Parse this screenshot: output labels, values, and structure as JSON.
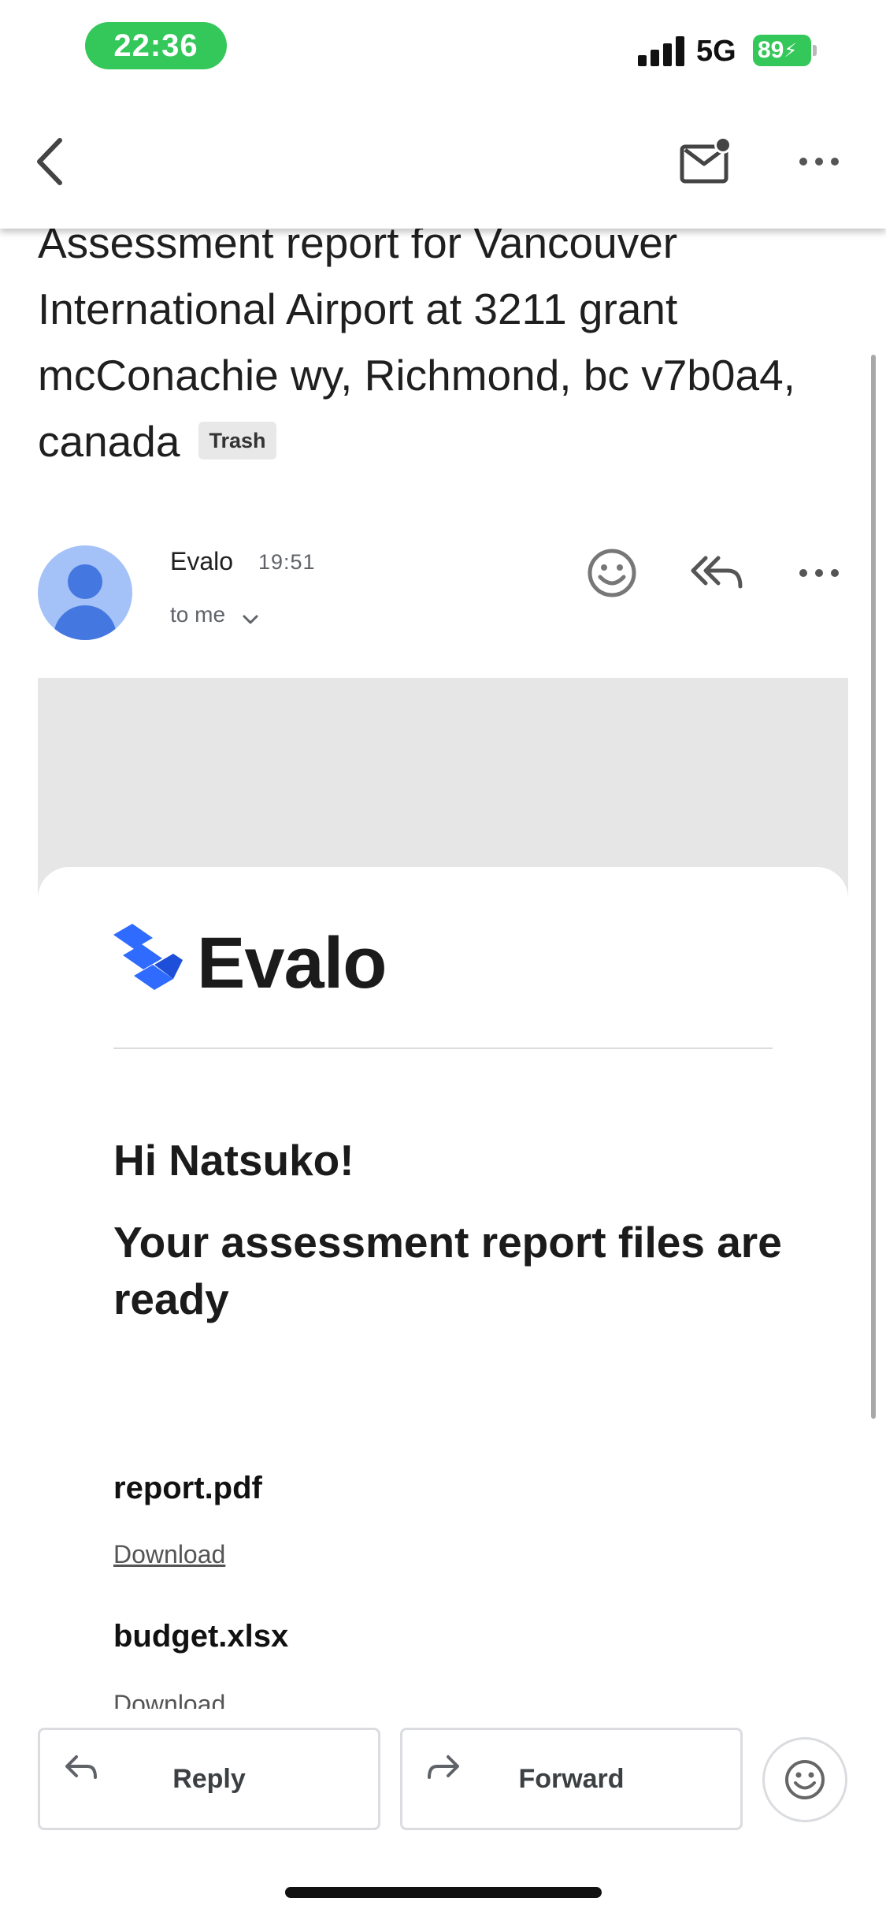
{
  "status_bar": {
    "time": "22:36",
    "network": "5G",
    "battery": "89",
    "accent_color": "#34c759"
  },
  "toolbar": {
    "back_icon": "chevron-left-icon",
    "mail_icon": "mark-unread-icon",
    "more_icon": "more-horizontal-icon"
  },
  "email": {
    "subject": "Assessment report for Vancouver International Airport at 3211 grant mcConachie wy, Richmond, bc v7b0a4, canada",
    "label": "Trash",
    "sender": "Evalo",
    "time": "19:51",
    "recipient": "to me"
  },
  "body": {
    "brand": "Evalo",
    "brand_color": "#2f6bff",
    "greeting": "Hi Natsuko!",
    "headline": "Your assessment report files are ready",
    "files": [
      {
        "name": "report.pdf",
        "link": "Download"
      },
      {
        "name": "budget.xlsx",
        "link": "Download"
      }
    ]
  },
  "actions": {
    "reply": "Reply",
    "forward": "Forward"
  }
}
